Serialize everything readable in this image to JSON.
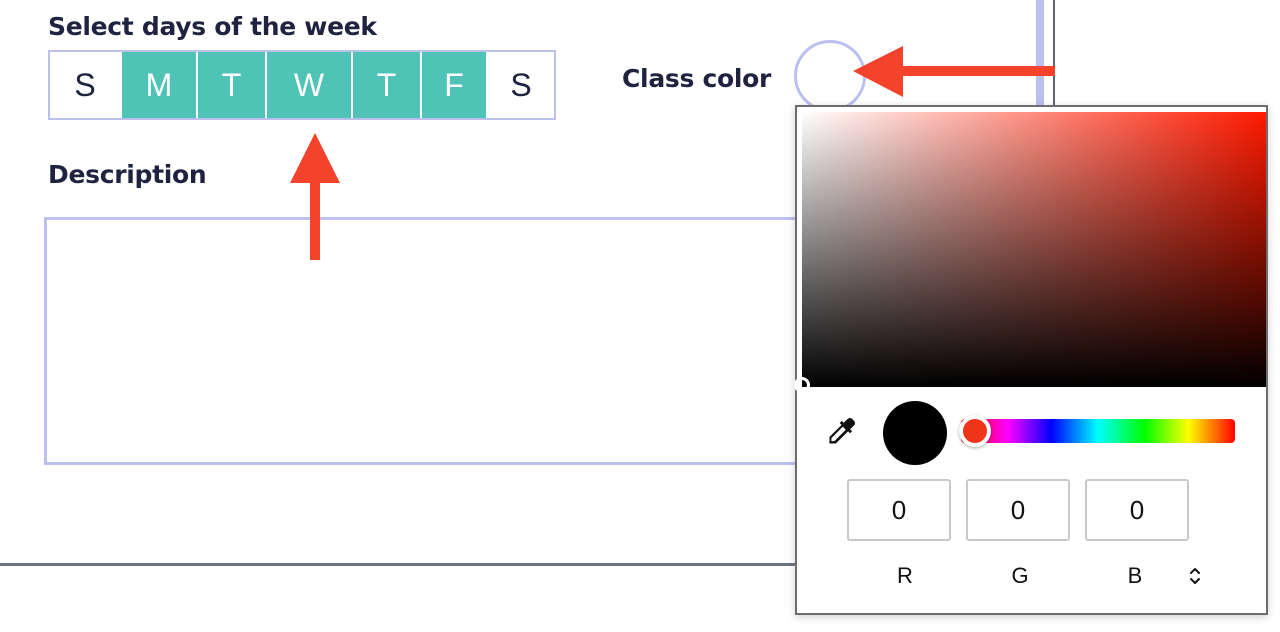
{
  "days_section": {
    "label": "Select days of the week",
    "days": [
      {
        "label": "S",
        "selected": false
      },
      {
        "label": "M",
        "selected": true
      },
      {
        "label": "T",
        "selected": true
      },
      {
        "label": "W",
        "selected": true
      },
      {
        "label": "T",
        "selected": true
      },
      {
        "label": "F",
        "selected": true
      },
      {
        "label": "S",
        "selected": false
      }
    ]
  },
  "class_color": {
    "label": "Class color",
    "swatch_color": "#ffffff"
  },
  "description": {
    "label": "Description",
    "value": ""
  },
  "color_picker": {
    "hue_color": "#ff1a00",
    "current_color": "#000000",
    "channels": [
      {
        "label": "R",
        "value": "0"
      },
      {
        "label": "G",
        "value": "0"
      },
      {
        "label": "B",
        "value": "0"
      }
    ],
    "mode_toggle_icon": "chevron-up-down-icon",
    "eyedropper_icon": "eyedropper-icon"
  },
  "colors": {
    "accent": "#4fc4b6",
    "border": "#bcc0ef",
    "annotation_arrow": "#f4432b",
    "text": "#1f2340"
  }
}
